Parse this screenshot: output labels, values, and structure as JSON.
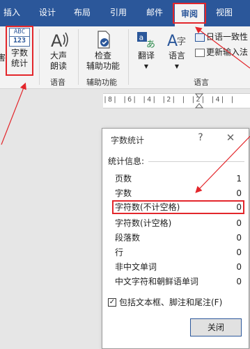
{
  "tabs": [
    {
      "label": "插入"
    },
    {
      "label": "设计"
    },
    {
      "label": "布局"
    },
    {
      "label": "引用"
    },
    {
      "label": "邮件"
    },
    {
      "label": "审阅"
    },
    {
      "label": "视图"
    }
  ],
  "active_tab": "审阅",
  "ribbon": {
    "word_count": {
      "icon_text": "ABC",
      "icon_num": "123",
      "label_1": "字数",
      "label_2": "统计"
    },
    "read_aloud": {
      "label_1": "大声",
      "label_2": "朗读"
    },
    "check_accessibility": {
      "label_1": "检查",
      "label_2": "辅助功能"
    },
    "translate": {
      "label": "翻译"
    },
    "language_btn": {
      "label": "语言"
    },
    "japanese_consistency": {
      "label": "日语一致性"
    },
    "update_ime": {
      "label": "更新输入法"
    },
    "group_left_cut": "害",
    "groups": {
      "speech": "语音",
      "accessibility": "辅助功能",
      "language": "语言"
    }
  },
  "ruler": {
    "text": "|8| |6| |4| |2| | |2| |4| |"
  },
  "dialog": {
    "title": "字数统计",
    "help_symbol": "?",
    "close_symbol": "✕",
    "section_label": "统计信息:",
    "stats": [
      {
        "label": "页数",
        "value": "1"
      },
      {
        "label": "字数",
        "value": "0"
      },
      {
        "label": "字符数(不计空格)",
        "value": "0"
      },
      {
        "label": "字符数(计空格)",
        "value": "0"
      },
      {
        "label": "段落数",
        "value": "0"
      },
      {
        "label": "行",
        "value": "0"
      },
      {
        "label": "非中文单词",
        "value": "0"
      },
      {
        "label": "中文字符和朝鲜语单词",
        "value": "0"
      }
    ],
    "checkbox_label": "包括文本框、脚注和尾注(F)",
    "checkbox_checked": true,
    "close_button": "关闭"
  },
  "colors": {
    "accent": "#2b579a",
    "highlight": "#e3262b"
  }
}
